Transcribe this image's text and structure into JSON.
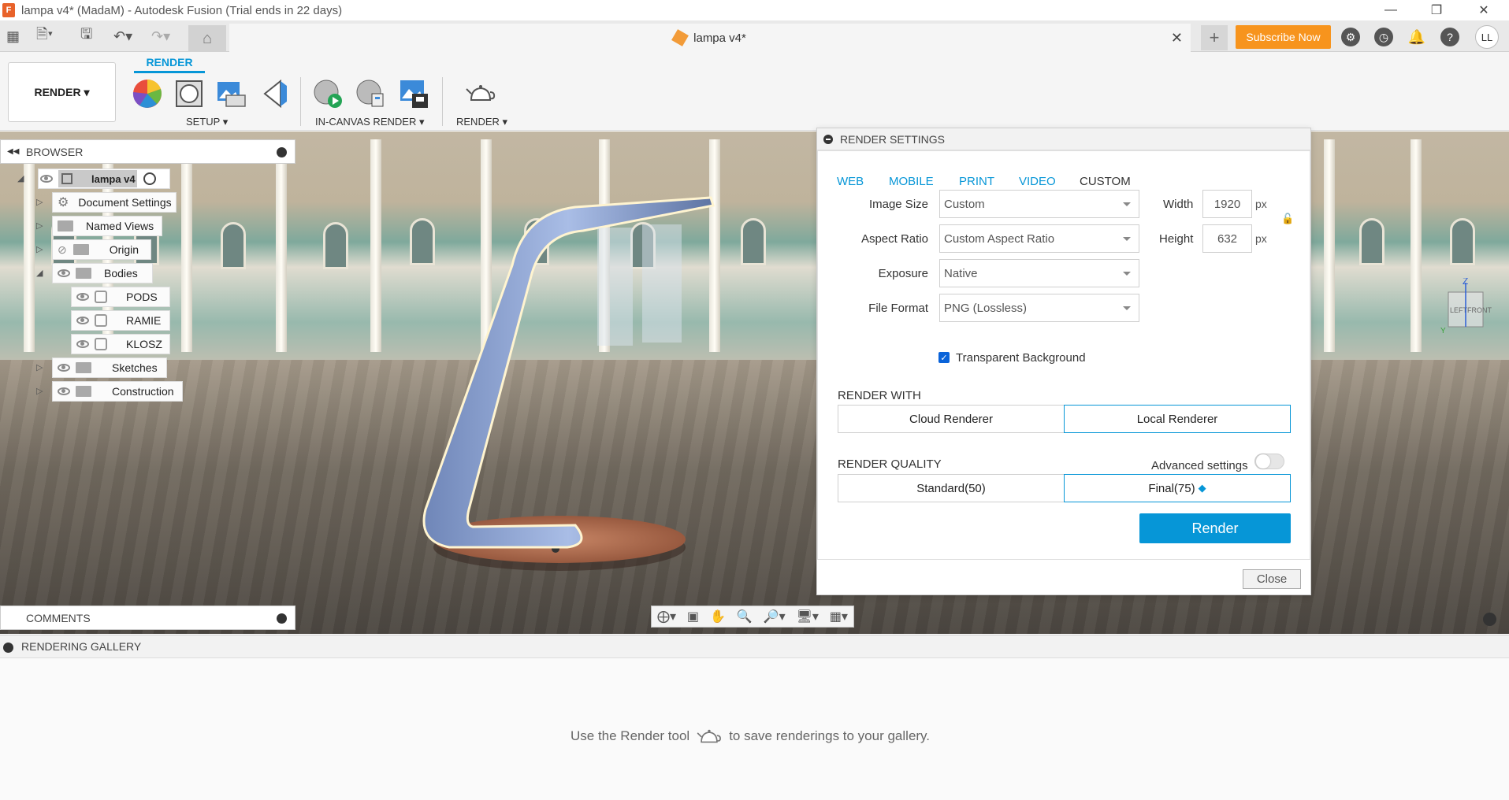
{
  "window": {
    "title": "lampa v4* (MadaM) - Autodesk Fusion (Trial ends in 22 days)",
    "app_icon_label": "F",
    "controls": [
      "minimize-icon",
      "restore-icon",
      "close-icon"
    ]
  },
  "tabbar": {
    "doc_tab_label": "lampa v4*",
    "subscribe_label": "Subscribe Now",
    "avatar_initials": "LL"
  },
  "ribbon": {
    "workspace_label": "RENDER",
    "active_tab": "RENDER",
    "groups": {
      "setup": "SETUP",
      "in_canvas": "IN-CANVAS RENDER",
      "render": "RENDER"
    }
  },
  "browser": {
    "title": "BROWSER",
    "root": "lampa v4",
    "items": {
      "document_settings": "Document Settings",
      "named_views": "Named Views",
      "origin": "Origin",
      "bodies": "Bodies",
      "pods": "PODS",
      "ramie": "RAMIE",
      "klosz": "KLOSZ",
      "sketches": "Sketches",
      "construction": "Construction"
    }
  },
  "comments": {
    "title": "COMMENTS"
  },
  "viewcube": {
    "top": "Z",
    "left": "LEFT",
    "front": "FRONT",
    "y": "Y"
  },
  "render_settings": {
    "title": "RENDER SETTINGS",
    "presets": [
      "WEB",
      "MOBILE",
      "PRINT",
      "VIDEO",
      "CUSTOM"
    ],
    "active_preset": "CUSTOM",
    "image_size_label": "Image Size",
    "image_size_value": "Custom",
    "aspect_ratio_label": "Aspect Ratio",
    "aspect_ratio_value": "Custom Aspect Ratio",
    "exposure_label": "Exposure",
    "exposure_value": "Native",
    "file_format_label": "File Format",
    "file_format_value": "PNG (Lossless)",
    "width_label": "Width",
    "width_value": "1920",
    "height_label": "Height",
    "height_value": "632",
    "unit": "px",
    "transparent_bg_label": "Transparent Background",
    "transparent_bg_checked": true,
    "render_with_title": "RENDER WITH",
    "cloud_renderer": "Cloud Renderer",
    "local_renderer": "Local Renderer",
    "render_quality_title": "RENDER QUALITY",
    "advanced_settings_label": "Advanced settings",
    "quality_standard": "Standard(50)",
    "quality_final": "Final(75)",
    "render_button": "Render",
    "close_button": "Close"
  },
  "gallery": {
    "title": "RENDERING GALLERY",
    "hint_before": "Use the Render tool",
    "hint_after": "to save renderings to your gallery."
  },
  "colors": {
    "accent": "#0696d7",
    "subscribe": "#f7941d"
  }
}
